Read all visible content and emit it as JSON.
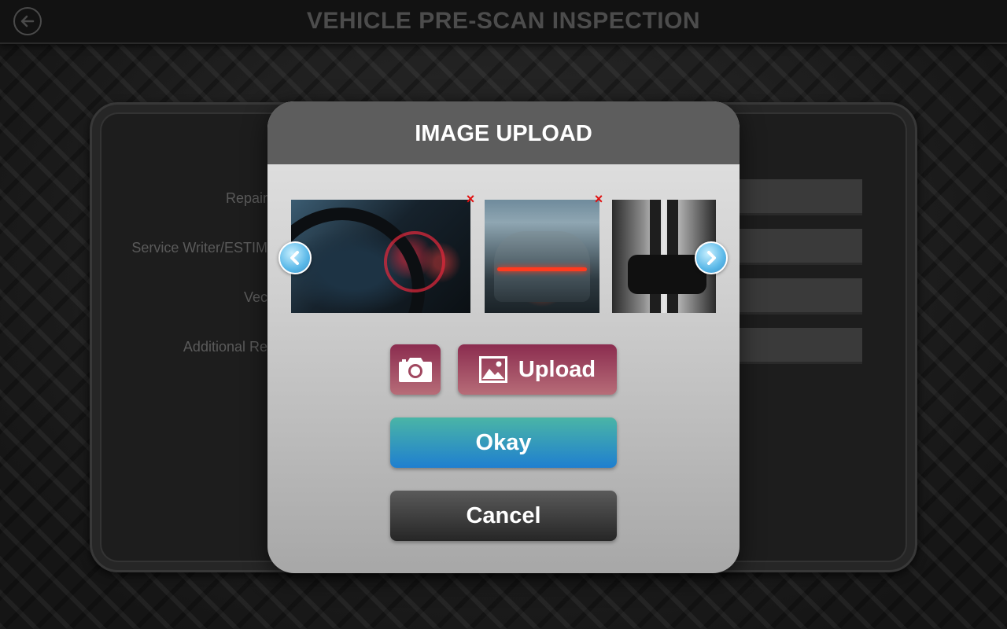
{
  "header": {
    "title": "VEHICLE PRE-SCAN INSPECTION",
    "back_icon": "back-arrow-icon"
  },
  "form": {
    "labels": [
      "Repair",
      "Service Writer/ESTIM",
      "Vec",
      "Additional Re"
    ]
  },
  "modal": {
    "title": "IMAGE UPLOAD",
    "thumbnails": [
      {
        "name": "dashboard-photo",
        "removable": true
      },
      {
        "name": "porsche-rear-photo",
        "removable": true
      },
      {
        "name": "mustang-front-photo",
        "removable": false
      }
    ],
    "remove_glyph": "×",
    "camera_icon": "camera-icon",
    "upload_label": "Upload",
    "okay_label": "Okay",
    "cancel_label": "Cancel"
  },
  "colors": {
    "upload_button": "#a0475f",
    "okay_button": "#1f7fd0",
    "cancel_button": "#3a3a3a",
    "remove": "#e01010"
  }
}
